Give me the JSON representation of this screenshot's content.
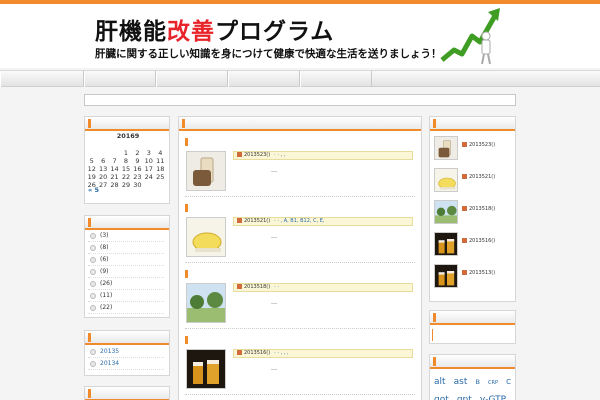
{
  "header": {
    "title_pre": "肝機能",
    "title_hl": "改善",
    "title_post": "プログラム",
    "subtitle": "肝臓に関する正しい知識を身につけて健康で快適な生活を送りましょう！",
    "colors": {
      "accent": "#f08a2a",
      "title_highlight": "#e8232a",
      "arrow": "#4caf2a"
    }
  },
  "nav": {
    "items": [
      "",
      "",
      "",
      "",
      ""
    ]
  },
  "calendar": {
    "title": "20169",
    "rows": [
      [
        "",
        "",
        "",
        "1",
        "2",
        "3",
        "4"
      ],
      [
        "5",
        "6",
        "7",
        "8",
        "9",
        "10",
        "11"
      ],
      [
        "12",
        "13",
        "14",
        "15",
        "16",
        "17",
        "18"
      ],
      [
        "19",
        "20",
        "21",
        "22",
        "23",
        "24",
        "25"
      ],
      [
        "26",
        "27",
        "28",
        "29",
        "30",
        "",
        ""
      ]
    ],
    "prev_link": "« 5"
  },
  "categories": {
    "items": [
      "(3)",
      "(8)",
      "(6)",
      "(9)",
      "(26)",
      "(11)",
      "(22)"
    ]
  },
  "archives": {
    "items": [
      "20135",
      "20134"
    ]
  },
  "posts": [
    {
      "date": "2013523()",
      "tags": "·  ·  , ,",
      "excerpt": "…",
      "thumb": "glass-icon"
    },
    {
      "date": "2013521()",
      "tags": "·  ·  , A, B1, B12, C, E,",
      "excerpt": "…",
      "thumb": "lemon-icon"
    },
    {
      "date": "2013518()",
      "tags": "·  ·",
      "excerpt": "…",
      "thumb": "park-icon"
    },
    {
      "date": "2013516()",
      "tags": "·  ·  , , ,",
      "excerpt": "…",
      "thumb": "beer-icon"
    }
  ],
  "recent": {
    "items": [
      {
        "date": "2013523()",
        "thumb": "glass-icon"
      },
      {
        "date": "2013521()",
        "thumb": "lemon-icon"
      },
      {
        "date": "2013518()",
        "thumb": "park-icon"
      },
      {
        "date": "2013516()",
        "thumb": "beer-icon"
      },
      {
        "date": "2013513()",
        "thumb": "beer-icon"
      }
    ]
  },
  "tagcloud": {
    "items": [
      {
        "text": "alt",
        "size": 9
      },
      {
        "text": "ast",
        "size": 9
      },
      {
        "text": "B",
        "size": 6.5
      },
      {
        "text": "CRP",
        "size": 5
      },
      {
        "text": "C",
        "size": 7
      },
      {
        "text": "got",
        "size": 9
      },
      {
        "text": "gpt",
        "size": 9
      },
      {
        "text": "γ-GTP",
        "size": 9
      }
    ]
  }
}
